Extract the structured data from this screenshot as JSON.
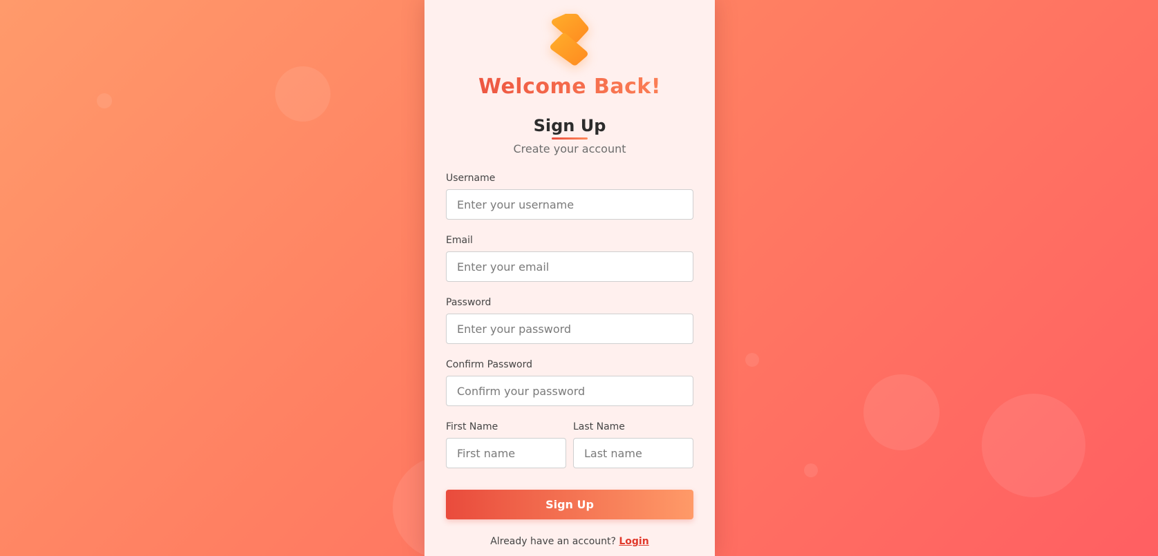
{
  "brand": {
    "logo_icon": "diagonal-bars-logo",
    "accent_start": "#e94b3c",
    "accent_end": "#ff8a5b"
  },
  "welcome_heading": "Welcome Back!",
  "form": {
    "title": "Sign Up",
    "subtitle": "Create your account",
    "fields": {
      "username": {
        "label": "Username",
        "placeholder": "Enter your username",
        "value": ""
      },
      "email": {
        "label": "Email",
        "placeholder": "Enter your email",
        "value": ""
      },
      "password": {
        "label": "Password",
        "placeholder": "Enter your password",
        "value": ""
      },
      "confirm_password": {
        "label": "Confirm Password",
        "placeholder": "Confirm your password",
        "value": ""
      },
      "first_name": {
        "label": "First Name",
        "placeholder": "First name",
        "value": ""
      },
      "last_name": {
        "label": "Last Name",
        "placeholder": "Last name",
        "value": ""
      }
    },
    "submit_label": "Sign Up",
    "footer_text": "Already have an account?",
    "footer_link": "Login"
  }
}
